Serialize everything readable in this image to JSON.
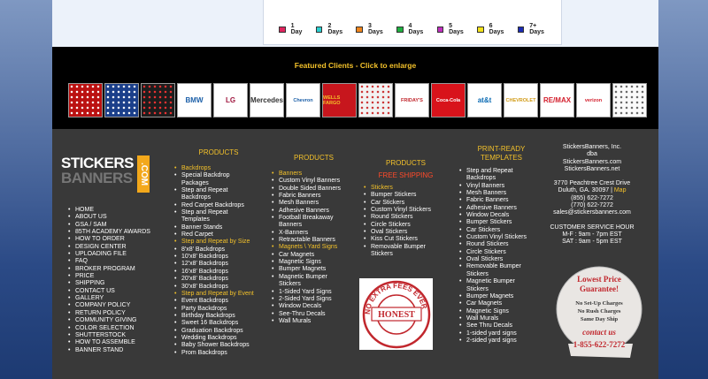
{
  "legend": [
    {
      "label": "1 Day",
      "color": "#e0245e"
    },
    {
      "label": "2 Days",
      "color": "#2ad1d1"
    },
    {
      "label": "3 Days",
      "color": "#f0861c"
    },
    {
      "label": "4 Days",
      "color": "#1fb040"
    },
    {
      "label": "5 Days",
      "color": "#c12fbf"
    },
    {
      "label": "6 Days",
      "color": "#f3e21a"
    },
    {
      "label": "7+ Days",
      "color": "#1b2bb5"
    }
  ],
  "featured": {
    "title": "Featured Clients - Click to enlarge",
    "logos": [
      "pattern-red",
      "pattern-blue",
      "pattern-dark",
      "BMW",
      "LG",
      "Mercedes",
      "Chevron",
      "WELLS FARGO",
      "pattern-light",
      "FRIDAY'S",
      "Coca-Cola",
      "at&t",
      "CHEVROLET",
      "RE/MAX",
      "verizon",
      "pattern-white"
    ]
  },
  "brand": {
    "line1": "STICKERS",
    "line2": "BANNERS",
    "com": ".COM"
  },
  "nav": [
    "HOME",
    "ABOUT US",
    "GSA / SAM",
    "85TH ACADEMY AWARDS",
    "HOW TO ORDER",
    "DESIGN CENTER",
    "UPLOADING FILE",
    "FAQ",
    "BROKER PROGRAM",
    "PRICE",
    "SHIPPING",
    "CONTACT US",
    "GALLERY",
    "COMPANY POLICY",
    "RETURN POLICY",
    "COMMUNITY GIVING",
    "COLOR SELECTION",
    "SHUTTERSTOCK",
    "HOW TO ASSEMBLE",
    "BANNER STAND"
  ],
  "col1": {
    "title": "PRODUCTS",
    "items": [
      {
        "t": "Backdrops",
        "hl": true
      },
      {
        "t": "Special Backdrop"
      },
      {
        "t": "Packages",
        "sub": true
      },
      {
        "t": "Step and Repeat"
      },
      {
        "t": "Backdrops",
        "sub": true
      },
      {
        "t": "Red Carpet Backdrops"
      },
      {
        "t": "Step and Repeat"
      },
      {
        "t": "Templates",
        "sub": true
      },
      {
        "t": "Banner Stands"
      },
      {
        "t": "Red Carpet"
      },
      {
        "t": "Step and Repeat by Size",
        "hl": true
      },
      {
        "t": "8'x8' Backdrops"
      },
      {
        "t": "10'x8' Backdrops"
      },
      {
        "t": "12'x8' Backdrops"
      },
      {
        "t": "16'x8' Backdrops"
      },
      {
        "t": "20'x8' Backdrops"
      },
      {
        "t": "30'x8' Backdrops"
      },
      {
        "t": "Step and Repeat by Event",
        "hl": true
      },
      {
        "t": "Event Backdrops"
      },
      {
        "t": "Party Backdrops"
      },
      {
        "t": "Birthday Backdrops"
      },
      {
        "t": "Sweet 16 Backdrops"
      },
      {
        "t": "Graduation Backdrops"
      },
      {
        "t": "Wedding Backdrops"
      },
      {
        "t": "Baby Shower Backdrops"
      },
      {
        "t": "Prom Backdrops"
      }
    ]
  },
  "col2": {
    "title": "PRODUCTS",
    "items": [
      {
        "t": "Banners",
        "hl": true
      },
      {
        "t": "Custom Vinyl Banners"
      },
      {
        "t": "Double Sided Banners"
      },
      {
        "t": "Fabric Banners"
      },
      {
        "t": "Mesh Banners"
      },
      {
        "t": "Adhesive Banners"
      },
      {
        "t": "Football Breakaway"
      },
      {
        "t": "Banners",
        "sub": true
      },
      {
        "t": "X-Banners"
      },
      {
        "t": "Retractable Banners"
      },
      {
        "t": "Magnets \\ Yard Signs",
        "hl": true
      },
      {
        "t": "Car Magnets"
      },
      {
        "t": "Magnetic Signs"
      },
      {
        "t": "Bumper Magnets"
      },
      {
        "t": "Magnetic Bumper"
      },
      {
        "t": "Stickers",
        "sub": true
      },
      {
        "t": "1-Sided Yard Signs"
      },
      {
        "t": "2-Sided Yard Signs"
      },
      {
        "t": "Window Decals"
      },
      {
        "t": "See-Thru Decals"
      },
      {
        "t": "Wall Murals"
      }
    ]
  },
  "col3": {
    "title": "PRODUCTS",
    "free_shipping": "FREE SHIPPING",
    "items": [
      {
        "t": "Stickers",
        "hl": true
      },
      {
        "t": "Bumper Stickers"
      },
      {
        "t": "Car Stickers"
      },
      {
        "t": "Custom Vinyl Stickers"
      },
      {
        "t": "Round Stickers"
      },
      {
        "t": "Circle Stickers"
      },
      {
        "t": "Oval Stickers"
      },
      {
        "t": "Kiss Cut Stickers"
      },
      {
        "t": "Removable Bumper"
      },
      {
        "t": "Stickers",
        "sub": true
      }
    ]
  },
  "col4": {
    "title1": "PRINT-READY",
    "title2": "TEMPLATES",
    "items": [
      {
        "t": "Step and Repeat"
      },
      {
        "t": "Backdrops",
        "sub": true
      },
      {
        "t": "Vinyl Banners"
      },
      {
        "t": "Mesh Banners"
      },
      {
        "t": "Fabric Banners"
      },
      {
        "t": "Adhesive Banners"
      },
      {
        "t": "Window Decals"
      },
      {
        "t": "Bumper Stickers"
      },
      {
        "t": "Car Stickers"
      },
      {
        "t": "Custom Vinyl Stickers"
      },
      {
        "t": "Round Stickers"
      },
      {
        "t": "Circle Stickers"
      },
      {
        "t": "Oval Stickers"
      },
      {
        "t": "Removable Bumper"
      },
      {
        "t": "Stickers",
        "sub": true
      },
      {
        "t": "Magnetic Bumper"
      },
      {
        "t": "Stickers",
        "sub": true
      },
      {
        "t": "Bumper Magnets"
      },
      {
        "t": "Car Magnets"
      },
      {
        "t": "Magnetic Signs"
      },
      {
        "t": "Wall Murals"
      },
      {
        "t": "See Thru Decals"
      },
      {
        "t": "1-sided yard signs"
      },
      {
        "t": "2-sided yard signs"
      }
    ]
  },
  "contact": {
    "company": "StickersBanners, Inc.",
    "dba": "dba",
    "site1": "StickersBanners.com",
    "site2": "StickersBanners.net",
    "address1": "3770 Peachtree Crest Drive",
    "address2_pre": "Duluth, GA. 30097 |",
    "map": "Map",
    "phone1": "(855) 622-7272",
    "phone2": "(770) 622-7272",
    "email": "sales@stickersbanners.com",
    "hours_title": "CUSTOMER SERVICE HOUR",
    "hours1": "M-F : 9am - 7pm EST",
    "hours2": "SAT : 9am - 5pm EST"
  },
  "stamp": {
    "center": "HONEST",
    "ring": "NO EXTRA FEES EVER"
  },
  "guarantee": {
    "title1": "Lowest Price",
    "title2": "Guarantee!",
    "lines": [
      "No Set-Up Charges",
      "No Rush Charges",
      "Same Day Ship"
    ],
    "contact": "contact us",
    "phone": "1-855-622-7272"
  }
}
